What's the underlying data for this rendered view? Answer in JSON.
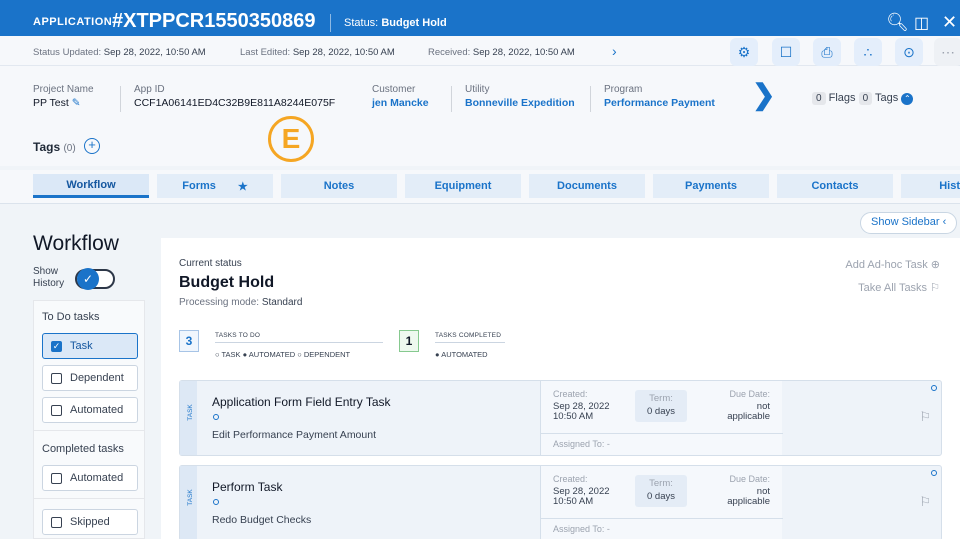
{
  "header": {
    "app_label": "APPLICATION",
    "app_id": "#XTPPCR1550350869",
    "status_prefix": "Status:",
    "status_value": "Budget Hold"
  },
  "subbar": {
    "status_updated_label": "Status Updated:",
    "status_updated": "Sep 28, 2022, 10:50 AM",
    "last_edited_label": "Last Edited:",
    "last_edited": "Sep 28, 2022, 10:50 AM",
    "received_label": "Received:",
    "received": "Sep 28, 2022, 10:50 AM"
  },
  "info": {
    "project_name_label": "Project Name",
    "project_name": "PP Test",
    "app_id_label": "App ID",
    "app_id": "CCF1A06141ED4C32B9E811A8244E075F",
    "customer_label": "Customer",
    "customer": "jen Mancke",
    "utility_label": "Utility",
    "utility": "Bonneville Expedition",
    "program_label": "Program",
    "program": "Performance Payment",
    "flags_count": "0",
    "flags_label": "Flags",
    "tags_count": "0",
    "tags_label": "Tags"
  },
  "badge_letter": "E",
  "tags": {
    "label": "Tags",
    "count": "(0)"
  },
  "tabs": [
    "Workflow",
    "Forms",
    "Notes",
    "Equipment",
    "Documents",
    "Payments",
    "Contacts",
    "Hist"
  ],
  "show_sidebar": "Show Sidebar",
  "sidebar": {
    "title": "Workflow",
    "history_label_1": "Show",
    "history_label_2": "History",
    "todo_section": "To Do tasks",
    "todo_filters": [
      "Task",
      "Dependent",
      "Automated"
    ],
    "completed_section": "Completed tasks",
    "completed_filters": [
      "Automated"
    ],
    "other_filters": [
      "Skipped"
    ]
  },
  "main": {
    "current_status_label": "Current status",
    "current_status": "Budget Hold",
    "processing_mode_label": "Processing mode:",
    "processing_mode": "Standard",
    "add_adhoc": "Add Ad-hoc Task",
    "take_all": "Take All Tasks",
    "todo_count": "3",
    "todo_title": "TASKS TO DO",
    "todo_legend": "○ TASK  ● AUTOMATED  ○ DEPENDENT",
    "completed_count": "1",
    "completed_title": "TASKS COMPLETED",
    "completed_legend": "● AUTOMATED"
  },
  "tasks": [
    {
      "type": "TASK",
      "name": "Application Form Field Entry Task",
      "description": "Edit Performance Payment Amount",
      "created_label": "Created:",
      "created_date": "Sep 28, 2022",
      "created_time": "10:50 AM",
      "term_label": "Term:",
      "term": "0 days",
      "due_label": "Due Date:",
      "due_1": "not",
      "due_2": "applicable",
      "assigned": "Assigned To: -"
    },
    {
      "type": "TASK",
      "name": "Perform Task",
      "description": "Redo Budget Checks",
      "created_label": "Created:",
      "created_date": "Sep 28, 2022",
      "created_time": "10:50 AM",
      "term_label": "Term:",
      "term": "0 days",
      "due_label": "Due Date:",
      "due_1": "not",
      "due_2": "applicable",
      "assigned": "Assigned To: -"
    }
  ],
  "colors": {
    "primary": "#1a73c9",
    "accent_badge": "#f5a623"
  }
}
